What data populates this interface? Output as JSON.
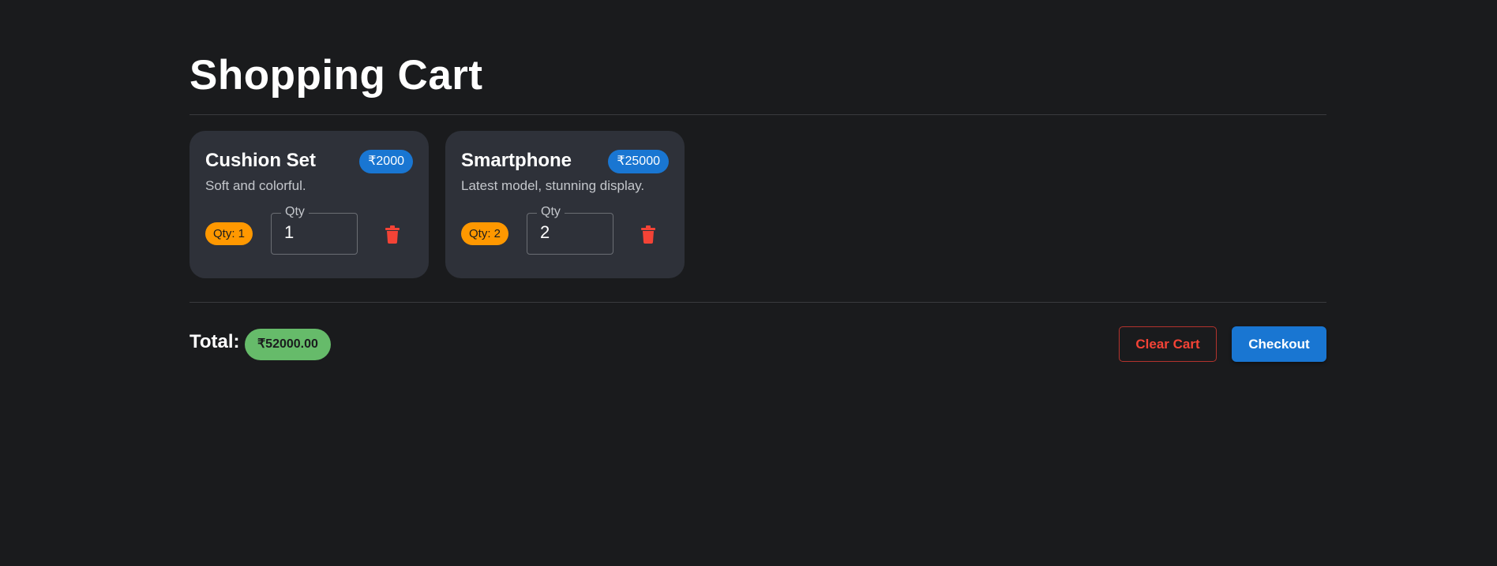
{
  "page": {
    "title": "Shopping Cart"
  },
  "cart": {
    "items": [
      {
        "name": "Cushion Set",
        "price": "₹2000",
        "description": "Soft and colorful.",
        "qty_chip": "Qty: 1",
        "qty_label": "Qty",
        "qty_value": "1"
      },
      {
        "name": "Smartphone",
        "price": "₹25000",
        "description": "Latest model, stunning display.",
        "qty_chip": "Qty: 2",
        "qty_label": "Qty",
        "qty_value": "2"
      }
    ]
  },
  "summary": {
    "total_label": "Total:",
    "total_value": "₹52000.00",
    "clear_label": "Clear Cart",
    "checkout_label": "Checkout"
  },
  "icons": {
    "delete": "trash-icon"
  },
  "colors": {
    "background": "#1a1b1d",
    "card": "#2e3139",
    "price_badge": "#1976d2",
    "qty_chip": "#ff9800",
    "total_badge": "#66bb6a",
    "danger": "#f44336",
    "primary": "#1976d2"
  }
}
